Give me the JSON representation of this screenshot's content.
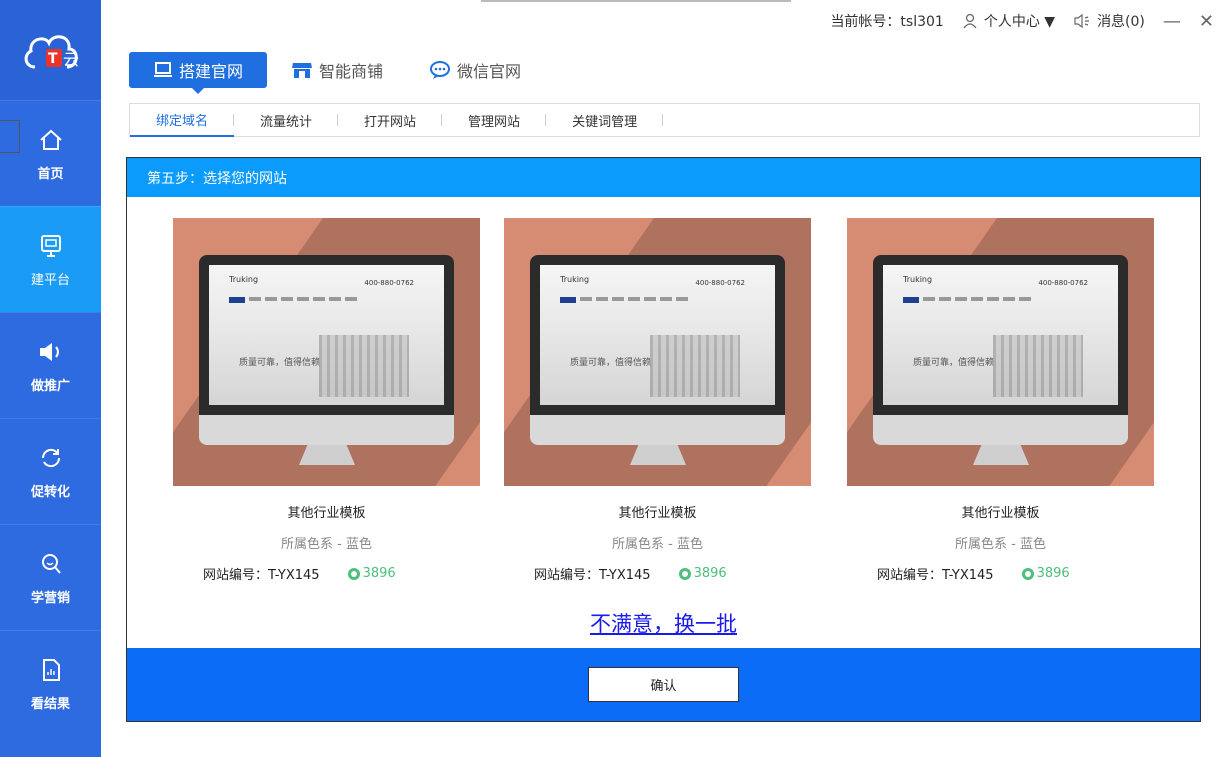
{
  "sidebar": {
    "logo_text": "T云",
    "items": [
      {
        "label": "首页",
        "icon": "home-icon"
      },
      {
        "label": "建平台",
        "icon": "monitor-icon"
      },
      {
        "label": "做推广",
        "icon": "speaker-icon"
      },
      {
        "label": "促转化",
        "icon": "refresh-icon"
      },
      {
        "label": "学营销",
        "icon": "search-icon"
      },
      {
        "label": "看结果",
        "icon": "report-icon"
      }
    ]
  },
  "topbar": {
    "account": "当前帐号：tsl301",
    "personal": "个人中心 ▼",
    "messages": "消息(0)",
    "minimize": "—",
    "close": "✕"
  },
  "main_tabs": [
    {
      "label": "搭建官网",
      "icon": "laptop-icon"
    },
    {
      "label": "智能商铺",
      "icon": "store-icon"
    },
    {
      "label": "微信官网",
      "icon": "wechat-icon"
    }
  ],
  "sub_tabs": [
    "绑定域名",
    "流量统计",
    "打开网站",
    "管理网站",
    "关键词管理"
  ],
  "panel": {
    "title": "第五步：选择您的网站",
    "refresh_link": "不满意，换一批",
    "confirm_label": "确认"
  },
  "templates": [
    {
      "title": "其他行业模板",
      "color_family": "所属色系 - 蓝色",
      "site_number": "网站编号：T-YX145",
      "views": "3896",
      "screen_logo": "Truking",
      "screen_phone": "400-880-0762",
      "screen_slogan": "质量可靠，值得信赖"
    },
    {
      "title": "其他行业模板",
      "color_family": "所属色系 - 蓝色",
      "site_number": "网站编号：T-YX145",
      "views": "3896",
      "screen_logo": "Truking",
      "screen_phone": "400-880-0762",
      "screen_slogan": "质量可靠，值得信赖"
    },
    {
      "title": "其他行业模板",
      "color_family": "所属色系 - 蓝色",
      "site_number": "网站编号：T-YX145",
      "views": "3896",
      "screen_logo": "Truking",
      "screen_phone": "400-880-0762",
      "screen_slogan": "质量可靠，值得信赖"
    }
  ],
  "colors": {
    "sidebar": "#2f6be0",
    "sidebar_active": "#1a9bf5",
    "panel_header": "#0b9bfc",
    "panel_footer": "#0a6cf7",
    "thumb_bg": "#d68b73",
    "views": "#4cbf7a"
  }
}
